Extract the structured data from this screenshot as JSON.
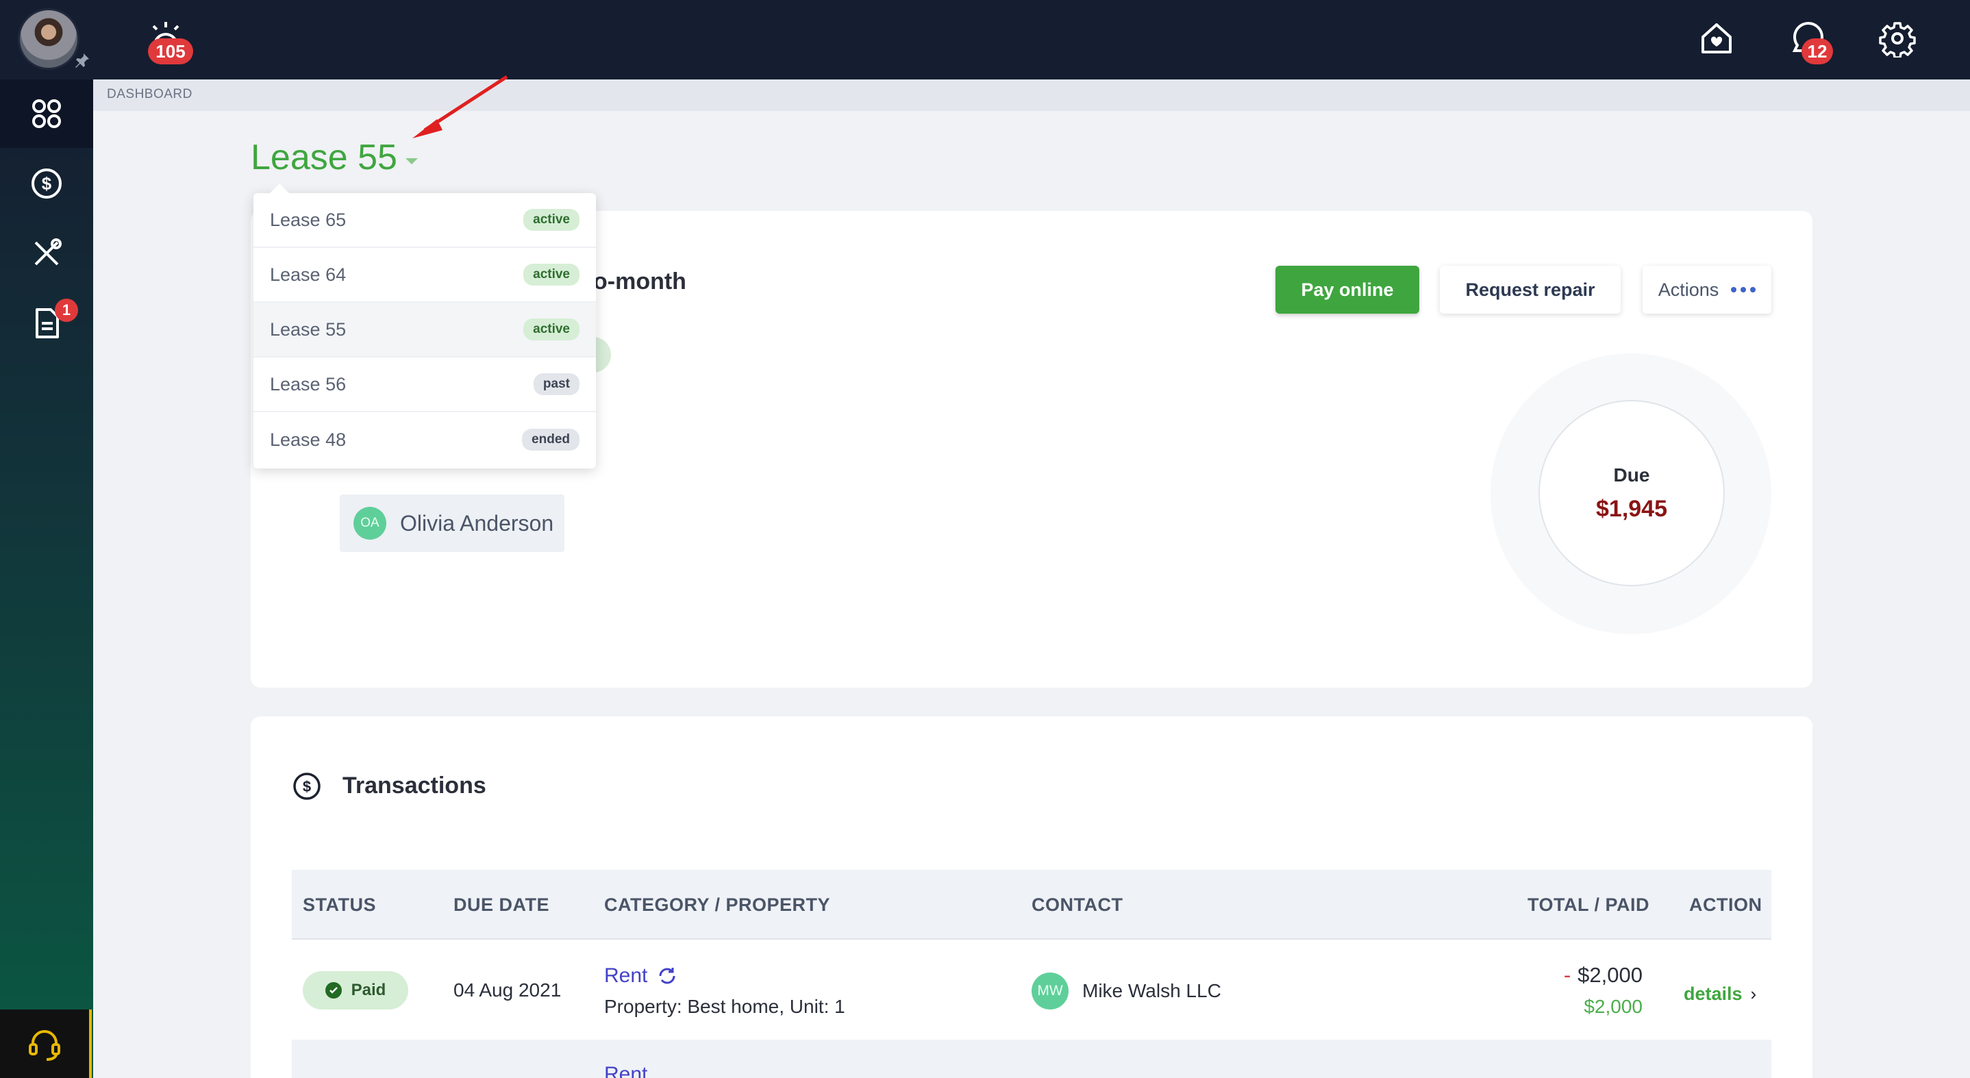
{
  "topbar": {
    "notifications_count": "105",
    "messages_count": "12"
  },
  "sidebar": {
    "documents_badge": "1"
  },
  "breadcrumb": "DASHBOARD",
  "lease": {
    "title": "Lease 55",
    "subtitle_partial": "o-month",
    "options": [
      {
        "label": "Lease 65",
        "status": "active"
      },
      {
        "label": "Lease 64",
        "status": "active"
      },
      {
        "label": "Lease 55",
        "status": "active"
      },
      {
        "label": "Lease 56",
        "status": "past"
      },
      {
        "label": "Lease 48",
        "status": "ended"
      }
    ]
  },
  "actions": {
    "pay": "Pay online",
    "repair": "Request repair",
    "more": "Actions"
  },
  "due": {
    "label": "Due",
    "amount": "$1,945"
  },
  "tenant": {
    "initials": "OA",
    "name": "Olivia Anderson"
  },
  "transactions": {
    "title": "Transactions",
    "columns": [
      "STATUS",
      "DUE DATE",
      "CATEGORY / PROPERTY",
      "CONTACT",
      "TOTAL / PAID",
      "ACTION"
    ],
    "rows": [
      {
        "status": "Paid",
        "due_date": "04 Aug 2021",
        "category": "Rent",
        "property": "Property: Best home, Unit: 1",
        "contact_initials": "MW",
        "contact": "Mike Walsh LLC",
        "total_sign": "-",
        "total": "$2,000",
        "paid": "$2,000",
        "action": "details"
      },
      {
        "category": "Rent"
      }
    ]
  },
  "colors": {
    "accent_green": "#3fa63f",
    "topbar": "#151d30",
    "due_red": "#8a1414",
    "link_blue": "#4342c8"
  }
}
